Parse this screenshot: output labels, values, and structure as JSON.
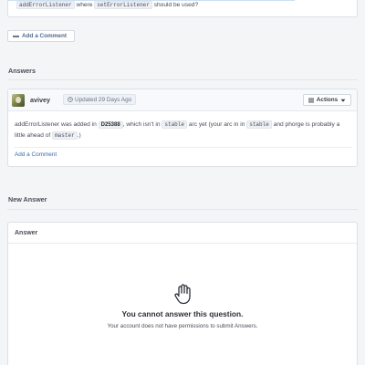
{
  "question": {
    "code_1": "addErrorListener",
    "text_1": "where",
    "code_2": "setErrorListener",
    "text_2": "should be used?"
  },
  "question_add_comment_label": "Add a Comment",
  "answers_section_title": "Answers",
  "answer": {
    "username": "avivey",
    "updated": "Updated 29 Days Ago",
    "actions_label": "Actions",
    "body": {
      "t1": "addErrorListener was added in",
      "rev": "D25388",
      "t2": ", which isn't in",
      "c1": "stable",
      "t3": "arc yet (your arc in in",
      "c2": "stable",
      "t4": "and phorge is probably a little ahead of",
      "c3": "master",
      "t5": ".)"
    },
    "add_comment_label": "Add a Comment"
  },
  "new_answer_section_title": "New Answer",
  "new_answer_card": {
    "title": "Answer",
    "message_title": "You cannot answer this question.",
    "message_body": "Your account does not have permissions to submit Answers."
  },
  "icons": {
    "comment": "comment-icon",
    "clock": "clock-icon",
    "menu": "bars-icon",
    "caret": "caret-down-icon",
    "hand": "hand-stop-icon"
  },
  "colors": {
    "link": "#3b6aa8",
    "background": "#f3f5f7",
    "card_border": "#dde1e6"
  }
}
